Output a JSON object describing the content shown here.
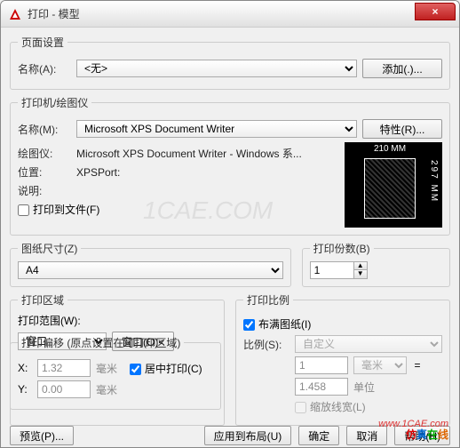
{
  "window": {
    "title": "打印 - 模型",
    "close": "×"
  },
  "pageSetup": {
    "legend": "页面设置",
    "nameLabel": "名称(A):",
    "nameValue": "<无>",
    "addBtn": "添加(.)..."
  },
  "printer": {
    "legend": "打印机/绘图仪",
    "nameLabel": "名称(M):",
    "nameValue": "Microsoft XPS Document Writer",
    "propsBtn": "特性(R)...",
    "plotLabel": "绘图仪:",
    "plotValue": "Microsoft XPS Document Writer - Windows 系...",
    "posLabel": "位置:",
    "posValue": "XPSPort:",
    "descLabel": "说明:",
    "descValue": "",
    "toFile": "打印到文件(F)",
    "preview": {
      "top": "210 MM",
      "side": "297 MM"
    }
  },
  "paper": {
    "legend": "图纸尺寸(Z)",
    "value": "A4"
  },
  "copies": {
    "legend": "打印份数(B)",
    "value": "1"
  },
  "area": {
    "legend": "打印区域",
    "rangeLabel": "打印范围(W):",
    "rangeValue": "窗口",
    "windowBtn": "窗口(O)<"
  },
  "scale": {
    "legend": "打印比例",
    "fit": "布满图纸(I)",
    "scaleLabel": "比例(S):",
    "scaleValue": "自定义",
    "num": "1",
    "numUnit": "毫米",
    "eq": "=",
    "den": "1.458",
    "denUnit": "单位",
    "scaleLw": "缩放线宽(L)"
  },
  "offset": {
    "legend": "打印偏移 (原点设置在可打印区域)",
    "xLabel": "X:",
    "xVal": "1.32",
    "xUnit": "毫米",
    "yLabel": "Y:",
    "yVal": "0.00",
    "yUnit": "毫米",
    "center": "居中打印(C)"
  },
  "buttons": {
    "preview": "预览(P)...",
    "apply": "应用到布局(U)",
    "ok": "确定",
    "cancel": "取消",
    "help": "帮助(H)"
  },
  "watermark": {
    "light": "1CAE.COM",
    "url": "www.1CAE.com",
    "brand": [
      "仿",
      "真",
      "在",
      "线"
    ]
  }
}
